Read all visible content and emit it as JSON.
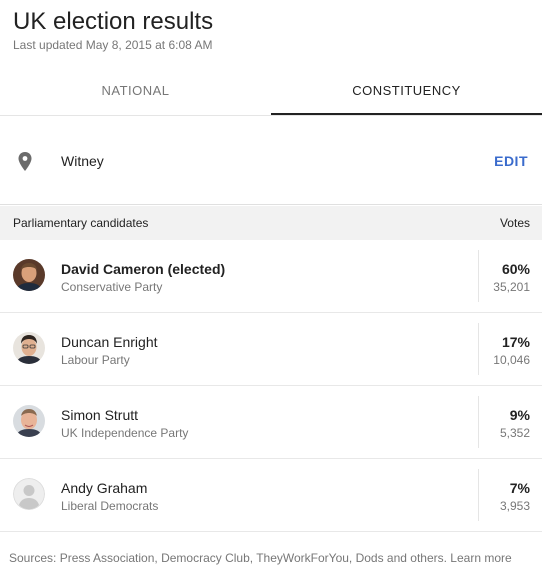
{
  "header": {
    "title": "UK election results",
    "updated": "Last updated May 8, 2015 at 6:08 AM"
  },
  "tabs": [
    {
      "label": "NATIONAL",
      "active": false
    },
    {
      "label": "CONSTITUENCY",
      "active": true
    }
  ],
  "location": {
    "icon": "location-pin-icon",
    "name": "Witney",
    "edit_label": "EDIT"
  },
  "table": {
    "left_header": "Parliamentary candidates",
    "right_header": "Votes",
    "candidates": [
      {
        "name": "David Cameron (elected)",
        "party": "Conservative Party",
        "percent": "60%",
        "votes": "35,201"
      },
      {
        "name": "Duncan Enright",
        "party": "Labour Party",
        "percent": "17%",
        "votes": "10,046"
      },
      {
        "name": "Simon Strutt",
        "party": "UK Independence Party",
        "percent": "9%",
        "votes": "5,352"
      },
      {
        "name": "Andy Graham",
        "party": "Liberal Democrats",
        "percent": "7%",
        "votes": "3,953"
      }
    ]
  },
  "footer": {
    "sources": "Sources: Press Association, Democracy Club, TheyWorkForYou, Dods and others. Learn more"
  },
  "colors": {
    "accent": "#3a6bcc",
    "secondary_text": "#777777",
    "header_bg": "#f2f2f2"
  }
}
